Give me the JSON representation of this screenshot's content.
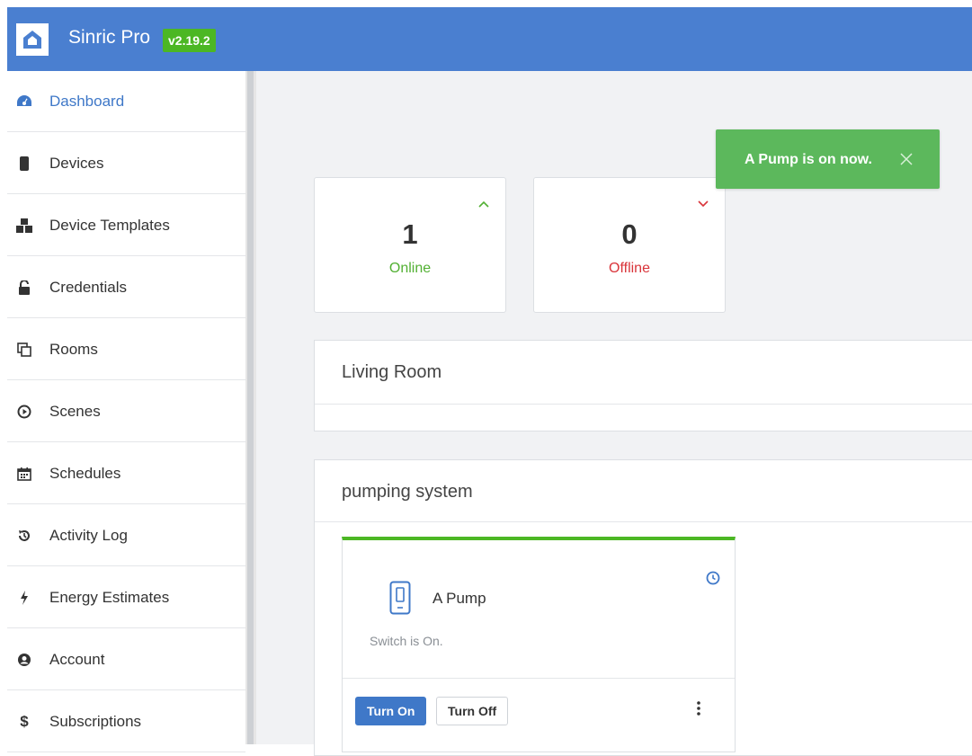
{
  "header": {
    "brand": "Sinric Pro",
    "version": "v2.19.2",
    "accent": "#4a7fd0",
    "version_color": "#4cb724"
  },
  "sidebar": {
    "items": [
      {
        "label": "Dashboard",
        "icon": "dashboard-icon",
        "active": true
      },
      {
        "label": "Devices",
        "icon": "device-icon"
      },
      {
        "label": "Device Templates",
        "icon": "cubes-icon"
      },
      {
        "label": "Credentials",
        "icon": "unlock-icon"
      },
      {
        "label": "Rooms",
        "icon": "clone-icon"
      },
      {
        "label": "Scenes",
        "icon": "play-circle-icon"
      },
      {
        "label": "Schedules",
        "icon": "calendar-icon"
      },
      {
        "label": "Activity Log",
        "icon": "history-icon"
      },
      {
        "label": "Energy Estimates",
        "icon": "bolt-icon"
      },
      {
        "label": "Account",
        "icon": "user-circle-icon"
      },
      {
        "label": "Subscriptions",
        "icon": "dollar-icon"
      }
    ]
  },
  "stats": {
    "online": {
      "count": "1",
      "label": "Online",
      "color": "#52b033"
    },
    "offline": {
      "count": "0",
      "label": "Offline",
      "color": "#d9343a"
    }
  },
  "rooms": [
    {
      "name": "Living Room"
    },
    {
      "name": "pumping system"
    }
  ],
  "device": {
    "name": "A Pump",
    "status": "Switch is On.",
    "turn_on_label": "Turn On",
    "turn_off_label": "Turn Off"
  },
  "toast": {
    "message": "A Pump is on now.",
    "color": "#5cb85c"
  }
}
